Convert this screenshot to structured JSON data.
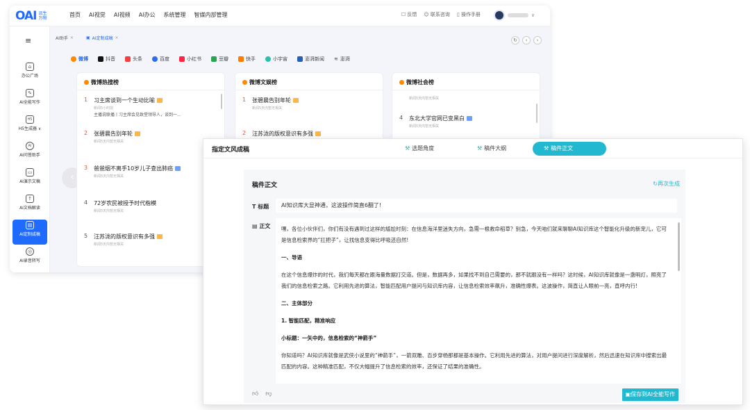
{
  "logo": {
    "mark": "OAI",
    "sub": "派生万物"
  },
  "nav": [
    "首页",
    "AI视觉",
    "AI视频",
    "AI办公",
    "系统管理",
    "智媒内部管理"
  ],
  "tools": [
    "反馈",
    "联系咨询",
    "操作手册"
  ],
  "sidebar": {
    "items": [
      {
        "label": "办公广场",
        "icon": "⌂"
      },
      {
        "label": "AI全能写作",
        "icon": "✎"
      },
      {
        "label": "H5生成器 ∨",
        "icon": "H5"
      },
      {
        "label": "AI问答助手",
        "icon": "AI"
      },
      {
        "label": "AI演示文稿",
        "icon": "▭"
      },
      {
        "label": "AI文档解读",
        "icon": "↑"
      },
      {
        "label": "AI定制成稿",
        "icon": "▤"
      },
      {
        "label": "AI录音转写",
        "icon": "◎"
      }
    ]
  },
  "tabs": [
    "AI助手",
    "AI定制成稿"
  ],
  "platforms": [
    "微博",
    "抖音",
    "头条",
    "百度",
    "小红书",
    "豆瓣",
    "快手",
    "小宇宙",
    "澎湃新闻",
    "澎湃"
  ],
  "cards": [
    {
      "title": "微博热搜榜",
      "items": [
        {
          "rank": "1",
          "title": "习主席谈到一个生动比喻",
          "meta": "新闻5小时前",
          "desc": "主播说联播丨习主席会见致堂领导人，谈到一..."
        },
        {
          "rank": "2",
          "title": "张碧晨告别年轮",
          "meta": "新闻5天内暂无相关"
        },
        {
          "rank": "3",
          "title": "爸爸烟不离手10岁儿子查出肺癌",
          "meta": "新闻5天内暂无相关"
        },
        {
          "rank": "4",
          "title": "72岁农民被授予时代楷模",
          "meta": "新闻5天内暂无相关"
        },
        {
          "rank": "5",
          "title": "汪苏泷的版权意识有多强",
          "meta": "新闻5天内暂无相关"
        }
      ]
    },
    {
      "title": "微博文娱榜",
      "items": [
        {
          "rank": "1",
          "title": "张碧晨告别年轮",
          "meta": "新闻5天内暂无相关"
        },
        {
          "rank": "2",
          "title": "汪苏泷的版权意识有多强",
          "meta": ""
        }
      ]
    },
    {
      "title": "微博社会榜",
      "items": [
        {
          "rank": "",
          "title": "",
          "meta": "新闻5天内暂无相关"
        },
        {
          "rank": "4",
          "title": "东北大学官网已变黑白",
          "meta": "新闻5天内暂无相关"
        }
      ]
    }
  ],
  "panel": {
    "title": "指定文风成稿",
    "tabs": [
      "选题角度",
      "稿件大纲",
      "稿件正文"
    ],
    "box_title": "稿件正文",
    "regen": "再次生成",
    "title_label": "标题",
    "body_label": "正文",
    "article_title": "AI知识库大显神通，这波操作简直6翻了!",
    "paragraphs": [
      "嘿，各位小伙伴们，你们有没有遇到过这样的尴尬时刻：在信息海洋里迷失方向，急需一根救命稻草？别急，今天咱们就来聊聊AI知识库这个智能化升级的新宠儿，它可是信息检索界的“扛把子”，让找信息变得比呼吸还自然!",
      "一、导语",
      "在这个信息爆炸的时代，我们每天都在跟海量数据打交道。但是，数据再多，如果找不到自己需要的，那不就跟没有一样吗？这时候，AI知识库就像是一盏明灯，照亮了我们的信息检索之路。它利用先进的算法，智能匹配用户提问与知识库内容，让信息检索效率飙升，准确性爆表。这波操作，简直让人眼前一亮，直呼内行!",
      "二、主体部分",
      "1. 智能匹配，精准响应",
      "小标题：一矢中的，信息检索的“神箭手”",
      "你知道吗？AI知识库就像是武侠小说里的“神箭手”，一箭双雕、百步穿杨那都是基本操作。它利用先进的算法，对用户提问进行深度解析，然后迅速在知识库中搜索出最匹配的内容。这种精准匹配，不仅大幅提升了信息检索的效率，还保证了结果的准确性。"
    ],
    "save": "保存到AI全能写作"
  }
}
